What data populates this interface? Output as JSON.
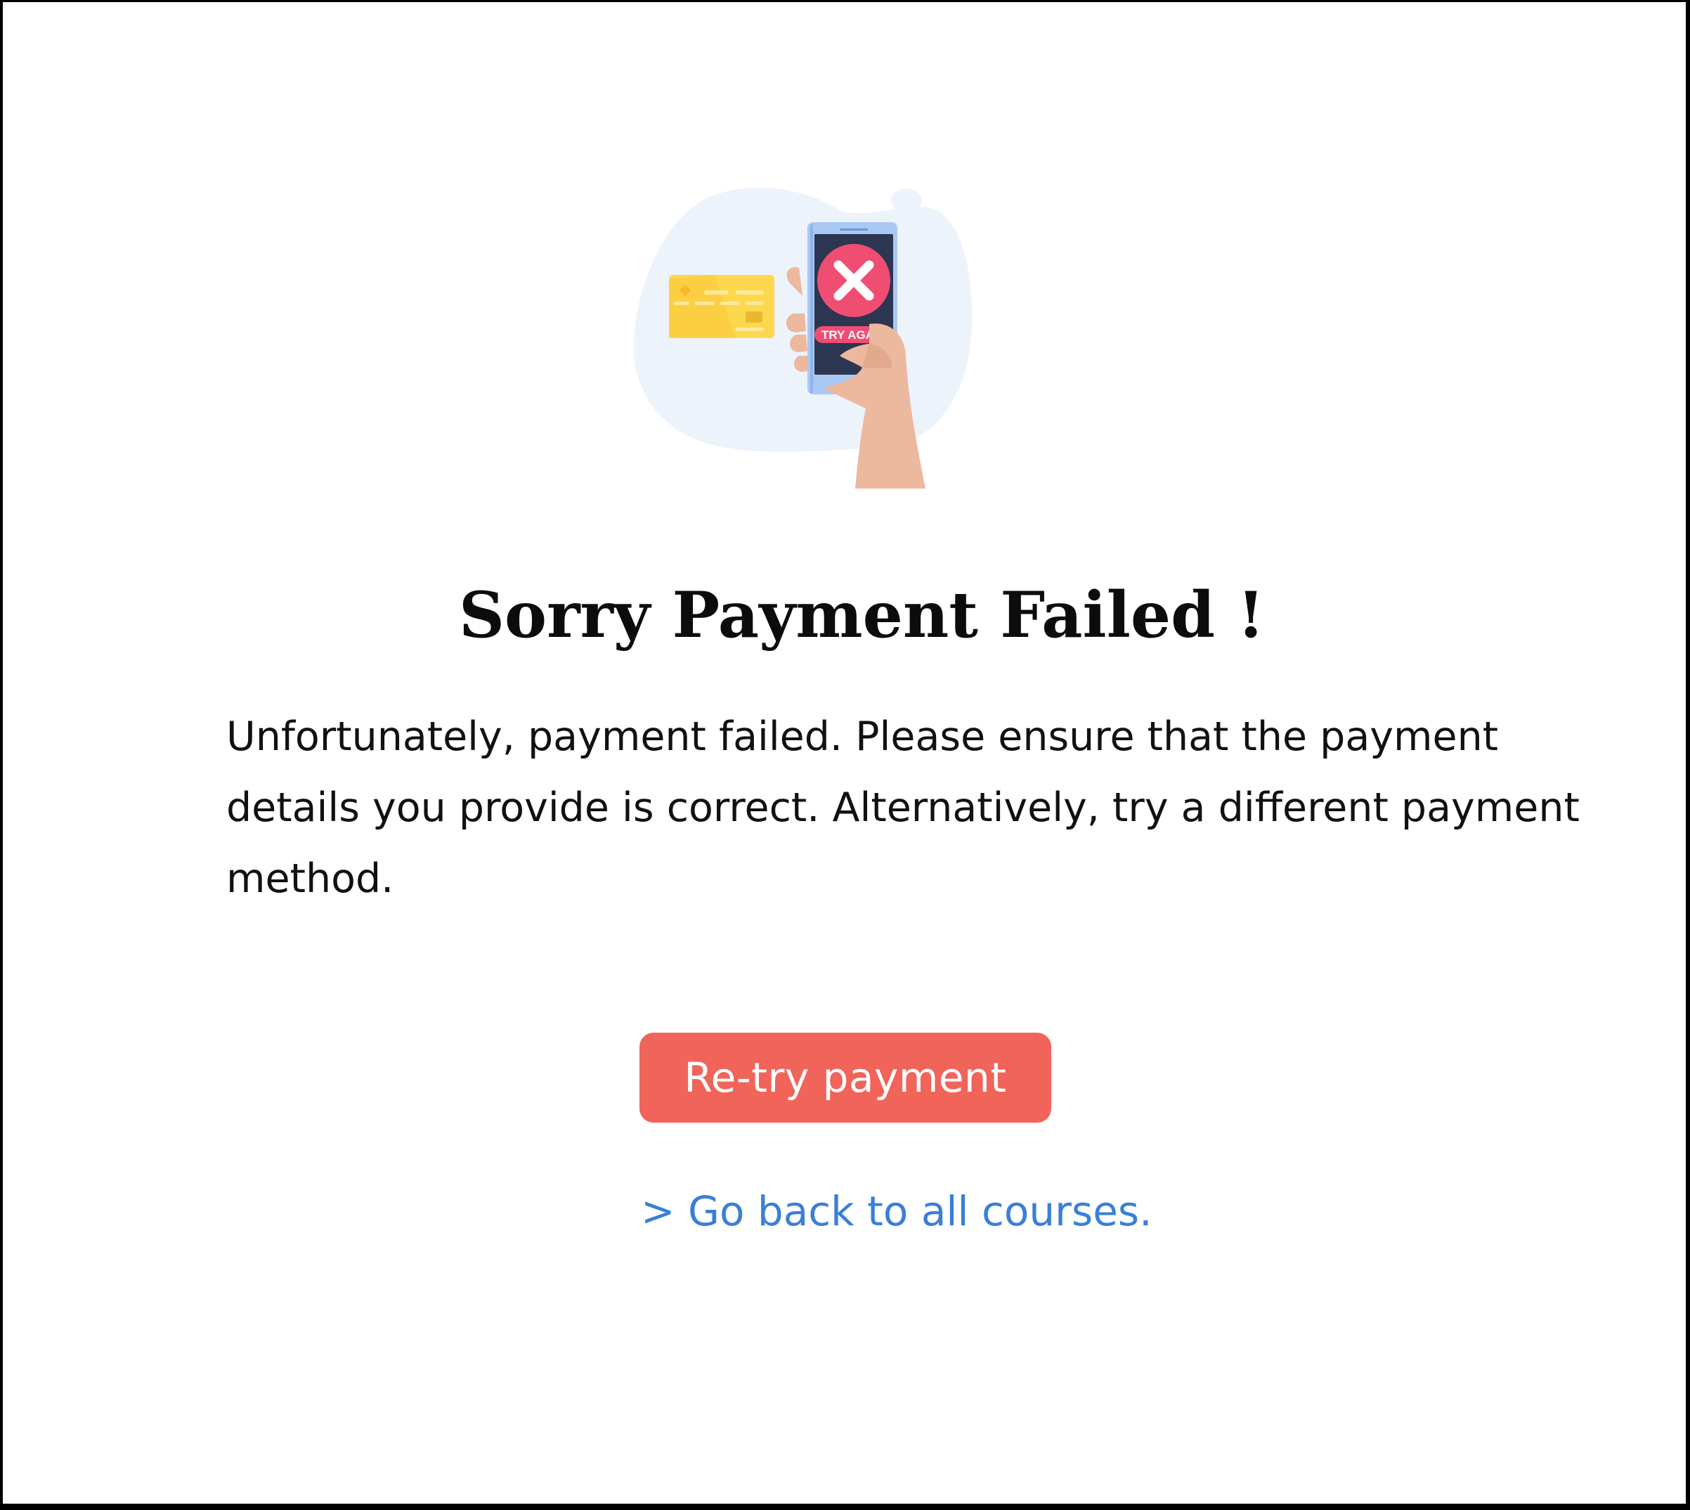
{
  "illustration": {
    "icon": "payment-failed-illustration",
    "phone_badge_label": "TRY AGAIN",
    "colors": {
      "blob": "#edf3fb",
      "card": "#fdd84e",
      "phone_body": "#a9c8f3",
      "phone_screen": "#2c3650",
      "error_circle": "#f04d73",
      "hand": "#ecb89e"
    }
  },
  "title": "Sorry Payment Failed !",
  "message": "Unfortunately, payment failed. Please ensure that the payment details you provide is correct. Alternatively, try a different payment method.",
  "retry_button": {
    "label": "Re-try payment",
    "color": "#f0645a"
  },
  "back_link": {
    "label": "> Go back to all courses.",
    "color": "#3a7fd8"
  }
}
